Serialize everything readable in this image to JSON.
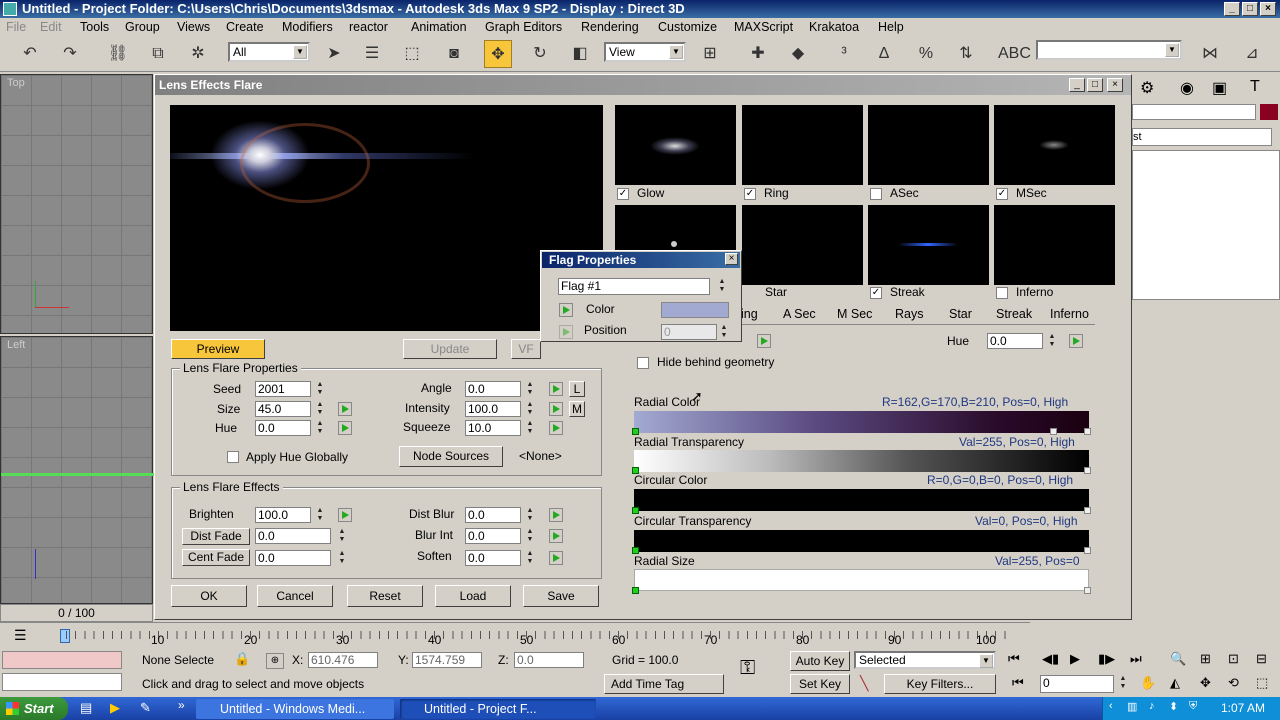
{
  "window": {
    "title": "Untitled    - Project Folder: C:\\Users\\Chris\\Documents\\3dsmax    - Autodesk 3ds Max 9 SP2    - Display : Direct 3D"
  },
  "menu": [
    "File",
    "Edit",
    "Tools",
    "Group",
    "Views",
    "Create",
    "Modifiers",
    "reactor",
    "Animation",
    "Graph Editors",
    "Rendering",
    "Customize",
    "MAXScript",
    "Krakatoa",
    "Help"
  ],
  "toolbar": {
    "selection_filter": "All",
    "ref_coord": "View"
  },
  "viewports": {
    "top_label": "Top",
    "left_label": "Left",
    "frame_counter": "0 / 100"
  },
  "dialog": {
    "title": "Lens Effects Flare",
    "preview_button": "Preview",
    "update_button": "Update",
    "vf_button": "VF",
    "thumbnails": [
      {
        "label": "Glow",
        "checked": true
      },
      {
        "label": "Ring",
        "checked": true
      },
      {
        "label": "ASec",
        "checked": false
      },
      {
        "label": "MSec",
        "checked": true
      },
      {
        "label": "Star",
        "checked": true
      },
      {
        "label": "Streak",
        "checked": true
      },
      {
        "label": "Inferno",
        "checked": false
      }
    ],
    "tabs": [
      "ing",
      "A Sec",
      "M Sec",
      "Rays",
      "Star",
      "Streak",
      "Inferno"
    ],
    "hue_label": "Hue",
    "hue_value": "0.0",
    "hide_behind": "Hide behind geometry",
    "lens_props": {
      "group_title": "Lens Flare Properties",
      "seed_label": "Seed",
      "seed": "2001",
      "size_label": "Size",
      "size": "45.0",
      "hue_label": "Hue",
      "hue": "0.0",
      "angle_label": "Angle",
      "angle": "0.0",
      "intensity_label": "Intensity",
      "intensity": "100.0",
      "squeeze_label": "Squeeze",
      "squeeze": "10.0",
      "l_btn": "L",
      "m_btn": "M",
      "apply_hue": "Apply Hue Globally",
      "node_sources": "Node Sources",
      "none": "<None>"
    },
    "lens_effects": {
      "group_title": "Lens Flare Effects",
      "brighten_label": "Brighten",
      "brighten": "100.0",
      "dist_fade": "Dist Fade",
      "dist_fade_val": "0.0",
      "cent_fade": "Cent Fade",
      "cent_fade_val": "0.0",
      "dist_blur_label": "Dist Blur",
      "dist_blur": "0.0",
      "blur_int_label": "Blur Int",
      "blur_int": "0.0",
      "soften_label": "Soften",
      "soften": "0.0"
    },
    "bottom_buttons": [
      "OK",
      "Cancel",
      "Reset",
      "Load",
      "Save"
    ],
    "gradients": [
      {
        "name": "Radial Color",
        "info": "R=162,G=170,B=210, Pos=0, High"
      },
      {
        "name": "Radial Transparency",
        "info": "Val=255, Pos=0, High"
      },
      {
        "name": "Circular Color",
        "info": "R=0,G=0,B=0, Pos=0, High"
      },
      {
        "name": "Circular Transparency",
        "info": "Val=0, Pos=0, High"
      },
      {
        "name": "Radial Size",
        "info": "Val=255, Pos=0"
      }
    ]
  },
  "flag_popup": {
    "title": "Flag Properties",
    "flag": "Flag #1",
    "color_label": "Color",
    "color_value": "#a2aad2",
    "position_label": "Position",
    "position_value": "0"
  },
  "timeline": {
    "ticks": [
      "10",
      "20",
      "30",
      "40",
      "50",
      "60",
      "70",
      "80",
      "90",
      "100"
    ]
  },
  "status": {
    "none_selected": "None Selecte",
    "x_label": "X:",
    "x": "610.476",
    "y_label": "Y:",
    "y": "1574.759",
    "z_label": "Z:",
    "z": "0.0",
    "grid": "Grid = 100.0",
    "auto_key": "Auto Key",
    "selected": "Selected",
    "set_key": "Set Key",
    "key_filters": "Key Filters...",
    "frame": "0",
    "prompt": "Click and drag to select and move objects",
    "add_time_tag": "Add Time Tag"
  },
  "taskbar": {
    "start": "Start",
    "tasks": [
      "Untitled - Windows Medi...",
      "Untitled    - Project F..."
    ],
    "clock": "1:07 AM"
  }
}
